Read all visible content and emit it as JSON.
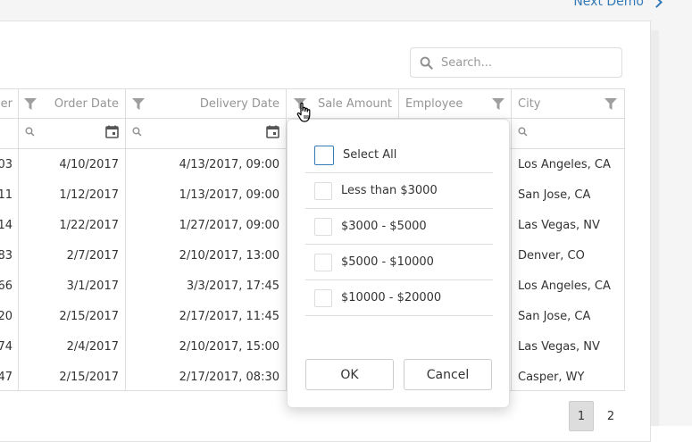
{
  "header": {
    "next_demo": "Next Demo"
  },
  "search": {
    "placeholder": "Search..."
  },
  "columns": {
    "order_number_partial": "er",
    "order_date": "Order Date",
    "delivery_date": "Delivery Date",
    "sale_amount": "Sale Amount",
    "employee": "Employee",
    "city": "City"
  },
  "rows": [
    {
      "order_no": "03",
      "order_date": "4/10/2017",
      "delivery_date": "4/13/2017, 09:00",
      "city": "Los Angeles, CA"
    },
    {
      "order_no": "11",
      "order_date": "1/12/2017",
      "delivery_date": "1/13/2017, 09:00",
      "city": "San Jose, CA"
    },
    {
      "order_no": "14",
      "order_date": "1/22/2017",
      "delivery_date": "1/27/2017, 09:00",
      "city": "Las Vegas, NV"
    },
    {
      "order_no": "83",
      "order_date": "2/7/2017",
      "delivery_date": "2/10/2017, 13:00",
      "city": "Denver, CO"
    },
    {
      "order_no": "66",
      "order_date": "3/1/2017",
      "delivery_date": "3/3/2017, 17:45",
      "city": "Los Angeles, CA"
    },
    {
      "order_no": "20",
      "order_date": "2/15/2017",
      "delivery_date": "2/17/2017, 11:45",
      "city": "San Jose, CA"
    },
    {
      "order_no": "74",
      "order_date": "2/4/2017",
      "delivery_date": "2/10/2017, 15:00",
      "city": "Las Vegas, NV"
    },
    {
      "order_no": "47",
      "order_date": "2/15/2017",
      "delivery_date": "2/17/2017, 08:30",
      "city": "Casper, WY"
    }
  ],
  "filter_popup": {
    "select_all": "Select All",
    "options": [
      "Less than $3000",
      "$3000 - $5000",
      "$5000 - $10000",
      "$10000 - $20000"
    ],
    "ok": "OK",
    "cancel": "Cancel"
  },
  "pager": {
    "pages": [
      "1",
      "2"
    ],
    "current": "1"
  },
  "colors": {
    "accent": "#337ab7",
    "header_text": "#959595",
    "border": "#dddddd",
    "icon_gray": "#9e9e9e"
  },
  "icons": {
    "filter": "funnel-icon",
    "search": "magnifier-icon",
    "calendar": "calendar-icon",
    "cursor": "hand-pointer-icon"
  }
}
